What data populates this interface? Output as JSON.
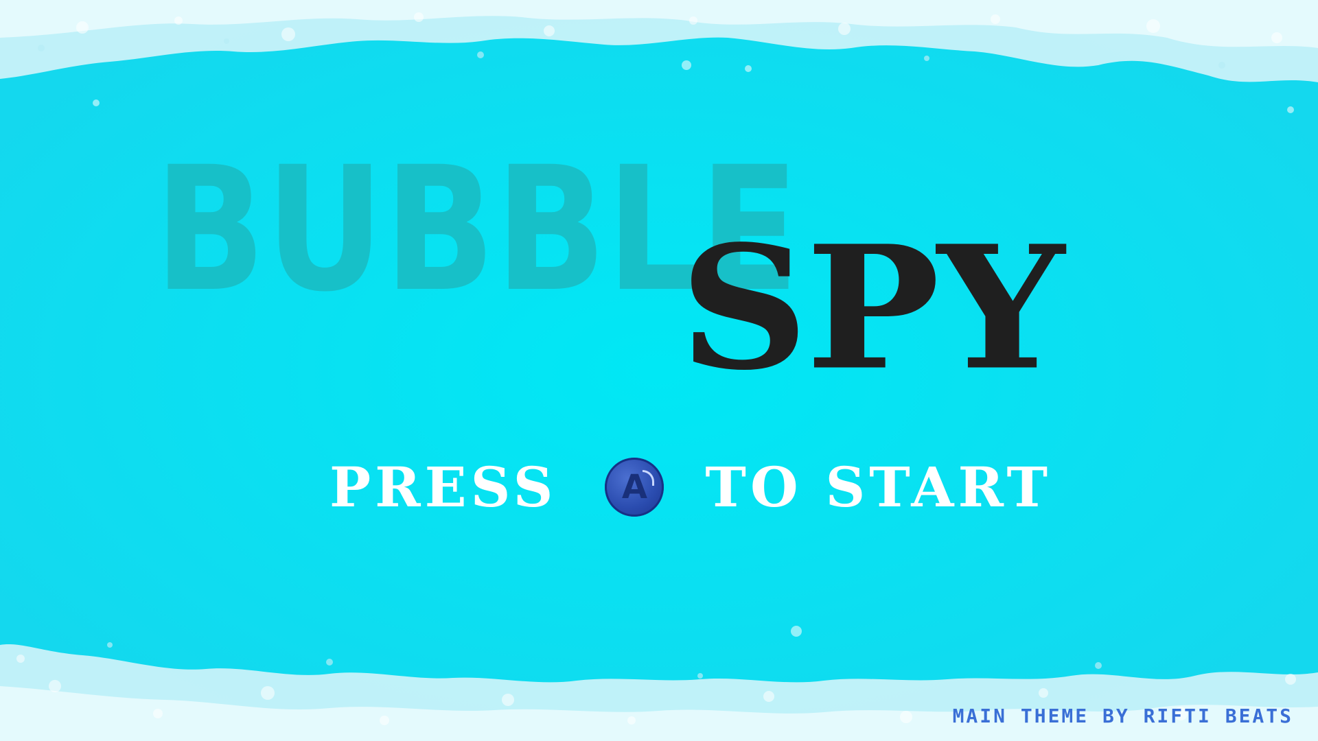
{
  "title": {
    "word1": "BUBBLE",
    "word2": "SPY",
    "word1_color": "#17c0c8",
    "word2_color": "#1f1f1f"
  },
  "prompt": {
    "before": "PRESS",
    "button_label": "A",
    "after": "TO START",
    "button_color": "#2b4db0"
  },
  "credit": "MAIN THEME BY RIFTI BEATS",
  "colors": {
    "water": "#00e5f2",
    "foam": "#d8f6fb",
    "text_light": "#ffffff",
    "credit": "#3a6fd6"
  }
}
